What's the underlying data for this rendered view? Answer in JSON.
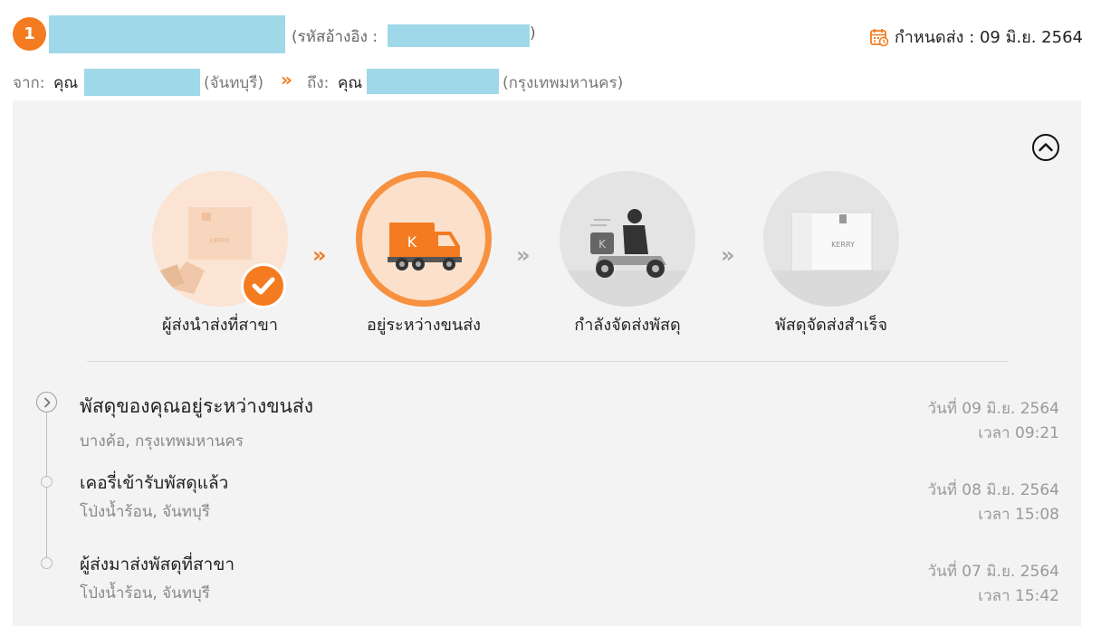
{
  "order": {
    "index": "1",
    "ref_prefix": "(รหัสอ้างอิง :",
    "ref_suffix": ")",
    "deadline": "กำหนดส่ง : 09 มิ.ย. 2564"
  },
  "route": {
    "from_label": "จาก:",
    "from_name": "คุณ",
    "from_province": "(จันทบุรี)",
    "to_label": "ถึง:",
    "to_name": "คุณ",
    "to_province": "(กรุงเทพมหานคร)"
  },
  "steps": [
    {
      "label": "ผู้ส่งนำส่งที่สาขา",
      "state": "done"
    },
    {
      "label": "อยู่ระหว่างขนส่ง",
      "state": "current"
    },
    {
      "label": "กำลังจัดส่งพัสดุ",
      "state": "pending"
    },
    {
      "label": "พัสดุจัดส่งสำเร็จ",
      "state": "pending"
    }
  ],
  "timeline": [
    {
      "title": "พัสดุของคุณอยู่ระหว่างขนส่ง",
      "location": "บางค้อ, กรุงเทพมหานคร",
      "date": "วันที่ 09 มิ.ย. 2564",
      "time": "เวลา 09:21"
    },
    {
      "title": "เคอรี่เข้ารับพัสดุแล้ว",
      "location": "โป่งน้ำร้อน, จันทบุรี",
      "date": "วันที่ 08 มิ.ย. 2564",
      "time": "เวลา 15:08"
    },
    {
      "title": "ผู้ส่งมาส่งพัสดุที่สาขา",
      "location": "โป่งน้ำร้อน, จันทบุรี",
      "date": "วันที่ 07 มิ.ย. 2564",
      "time": "เวลา 15:42"
    }
  ],
  "colors": {
    "accent": "#f47b20",
    "redaction": "#9fd8e8",
    "panel": "#f3f3f3"
  },
  "icons": [
    "calendar-icon",
    "double-chevron-icon",
    "chevron-up-circle-icon",
    "check-icon",
    "chevron-right-circle-icon"
  ]
}
